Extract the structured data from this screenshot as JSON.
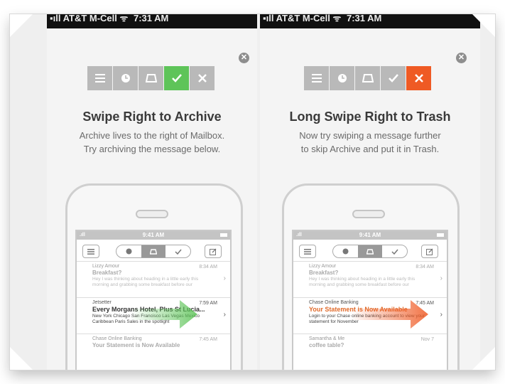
{
  "left": {
    "statusbar": {
      "carrier": "▪ıll AT&T M-Cell ᯤ",
      "time": "7:31 AM"
    },
    "heading": "Swipe Right to Archive",
    "description_line1": "Archive lives to the right of Mailbox.",
    "description_line2": "Try archiving the message below.",
    "tabs": [
      "list-icon",
      "clock-icon",
      "inbox-icon",
      "check-icon",
      "x-icon"
    ],
    "active_tab_color": "#5ec459",
    "phone": {
      "time": "9:41 AM",
      "messages": [
        {
          "from": "Lizzy Amour",
          "subject": "Breakfast?",
          "snippet": "Hey I was thinking about heading in a little early this morning and grabbing some breakfast before our",
          "time": "8:34 AM",
          "bold": false
        },
        {
          "from": "Jetsetter",
          "subject": "Every Morgans Hotel, Plus St Lucia...",
          "snippet": "New York Chicago San Francisco Las Vegas Mexico Caribbean Paris Sales in the spotlight",
          "time": "7:59 AM",
          "bold": true
        },
        {
          "from": "Chase Online Banking",
          "subject": "Your Statement is Now Available",
          "snippet": "",
          "time": "7:45 AM",
          "bold": false
        }
      ]
    }
  },
  "right": {
    "statusbar": {
      "carrier": "▪ıll AT&T M-Cell ᯤ",
      "time": "7:31 AM"
    },
    "heading": "Long Swipe Right to Trash",
    "description_line1": "Now try swiping a message further",
    "description_line2": "to skip Archive and put it in Trash.",
    "tabs": [
      "list-icon",
      "clock-icon",
      "inbox-icon",
      "check-icon",
      "x-icon"
    ],
    "active_tab_color": "#ef5a24",
    "phone": {
      "time": "9:41 AM",
      "messages": [
        {
          "from": "Lizzy Amour",
          "subject": "Breakfast?",
          "snippet": "Hey I was thinking about heading in a little early this morning and grabbing some breakfast before our",
          "time": "8:34 AM",
          "bold": false
        },
        {
          "from": "Chase Online Banking",
          "subject": "Your Statement is Now Available",
          "snippet": "Login to your Chase online banking account to view your statement for November",
          "time": "7:45 AM",
          "bold": true
        },
        {
          "from": "Samantha & Me",
          "subject": "coffee table?",
          "snippet": "",
          "time": "Nov 7",
          "bold": false
        }
      ]
    }
  },
  "close_symbol": "✕"
}
